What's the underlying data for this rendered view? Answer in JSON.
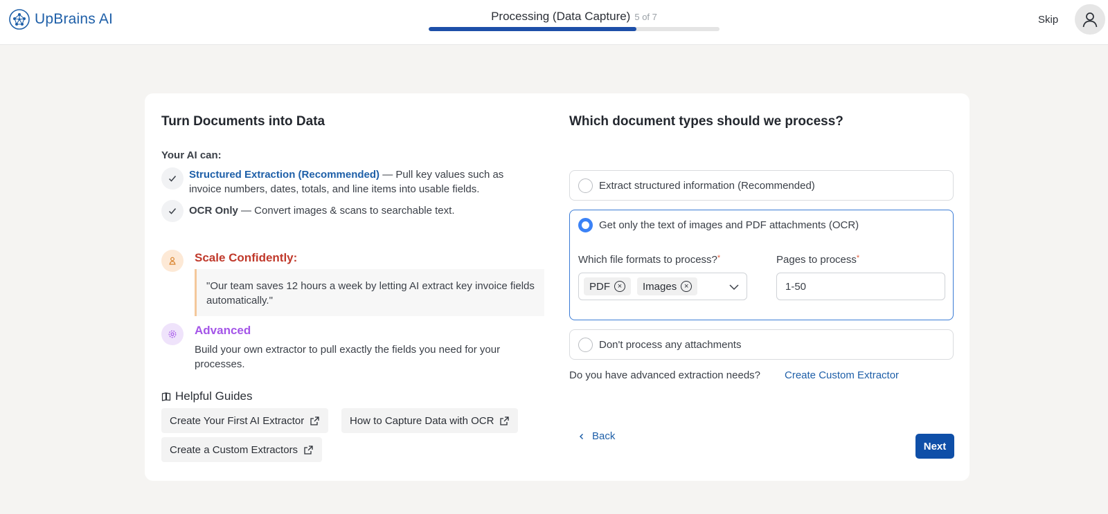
{
  "brand": {
    "name": "UpBrains AI",
    "logo_icon": "brain-network-icon"
  },
  "progress": {
    "title": "Processing (Data Capture)",
    "step_label": "5 of 7",
    "fraction": 0.714
  },
  "header": {
    "skip_label": "Skip",
    "avatar_icon": "user-icon"
  },
  "left": {
    "title": "Turn Documents into Data",
    "ai_can": "Your AI can:",
    "features": [
      {
        "name": "Structured Extraction (Recommended)",
        "desc": " — Pull key values such as invoice numbers, dates, totals, and line items into usable fields."
      },
      {
        "name": "OCR Only",
        "desc": " — Convert images & scans to searchable text."
      }
    ],
    "scale": {
      "title": "Scale Confidently:",
      "quote": "\"Our team saves 12 hours a week by letting AI extract key invoice fields automatically.\""
    },
    "advanced": {
      "title": "Advanced",
      "desc": "Build your own extractor to pull exactly the fields you need for your processes."
    },
    "guides": {
      "title": "Helpful Guides",
      "items": [
        "Create Your First AI Extractor",
        "How to Capture Data with OCR",
        "Create a Custom Extractors"
      ]
    }
  },
  "right": {
    "question": "Which document types should we process?",
    "options": [
      "Extract structured information (Recommended)",
      "Get only the text of images and PDF attachments (OCR)",
      "Don't process any attachments"
    ],
    "selected_option": 1,
    "formats_label": "Which file formats to process?",
    "formats": [
      "PDF",
      "Images"
    ],
    "pages_label": "Pages to process",
    "pages_value": "1-50",
    "required_mark": "*",
    "advanced_question": "Do you have advanced extraction needs?",
    "advanced_link": "Create Custom Extractor",
    "back_label": "Back",
    "next_label": "Next"
  },
  "colors": {
    "brand_blue": "#1e5fa8",
    "primary_button": "#0f4fa8",
    "scale_red": "#c0392b",
    "advanced_purple": "#a455e8",
    "selected_border": "#3a7bd5"
  }
}
